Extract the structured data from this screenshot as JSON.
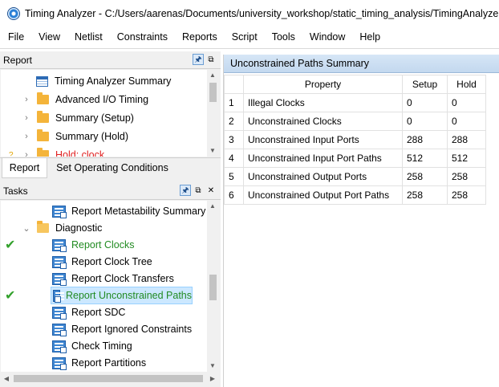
{
  "window": {
    "title": "Timing Analyzer - C:/Users/aarenas/Documents/university_workshop/static_timing_analysis/TimingAnalyzer_res"
  },
  "menu": [
    "File",
    "View",
    "Netlist",
    "Constraints",
    "Reports",
    "Script",
    "Tools",
    "Window",
    "Help"
  ],
  "report_pane": {
    "title": "Report",
    "items": [
      {
        "label": "Timing Analyzer Summary",
        "color": "#000000",
        "icon": "table-icon"
      },
      {
        "label": "Advanced I/O Timing",
        "color": "#000000",
        "icon": "folder-icon"
      },
      {
        "label": "Summary (Setup)",
        "color": "#000000",
        "icon": "folder-icon"
      },
      {
        "label": "Summary (Hold)",
        "color": "#000000",
        "icon": "folder-icon"
      },
      {
        "label": "Hold: clock",
        "color": "#e02020",
        "icon": "folder-icon"
      }
    ]
  },
  "tabs": [
    "Report",
    "Set Operating Conditions"
  ],
  "tasks_pane": {
    "title": "Tasks",
    "items": [
      {
        "label": "Report Metastability Summary",
        "color": "#000000"
      },
      {
        "label": "Diagnostic",
        "color": "#000000"
      },
      {
        "label": "Report Clocks",
        "color": "#228b22"
      },
      {
        "label": "Report Clock Tree",
        "color": "#000000"
      },
      {
        "label": "Report Clock Transfers",
        "color": "#000000"
      },
      {
        "label": "Report Unconstrained Paths",
        "color": "#228b22"
      },
      {
        "label": "Report SDC",
        "color": "#000000"
      },
      {
        "label": "Report Ignored Constraints",
        "color": "#000000"
      },
      {
        "label": "Check Timing",
        "color": "#000000"
      },
      {
        "label": "Report Partitions",
        "color": "#000000"
      }
    ]
  },
  "summary": {
    "title": "Unconstrained Paths Summary",
    "columns": [
      "",
      "Property",
      "Setup",
      "Hold"
    ],
    "rows": [
      [
        "1",
        "Illegal Clocks",
        "0",
        "0"
      ],
      [
        "2",
        "Unconstrained Clocks",
        "0",
        "0"
      ],
      [
        "3",
        "Unconstrained Input Ports",
        "288",
        "288"
      ],
      [
        "4",
        "Unconstrained Input Port Paths",
        "512",
        "512"
      ],
      [
        "5",
        "Unconstrained Output Ports",
        "258",
        "258"
      ],
      [
        "6",
        "Unconstrained Output Port Paths",
        "258",
        "258"
      ]
    ]
  },
  "colors": {
    "selection": "#cce8ff",
    "header_bg": "#c9dcf1",
    "success_green": "#228b22",
    "error_red": "#e02020"
  }
}
